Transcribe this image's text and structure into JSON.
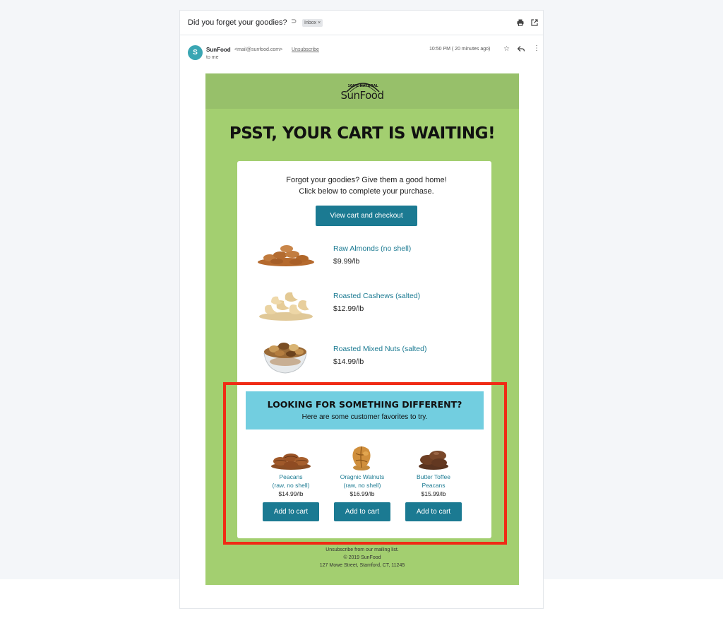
{
  "email": {
    "subject": "Did you forget your goodies?",
    "label": "Inbox",
    "label_close": "×",
    "sender_initial": "S",
    "sender_name": "SunFood",
    "sender_email": "<mail@sunfood.com>",
    "unsubscribe_link": "Unsubscribe",
    "recipient": "to me",
    "timestamp": "10:50 PM ( 20 minutes ago)"
  },
  "brand": {
    "logo_top": "100% NATURAL",
    "logo_name": "SunFood",
    "header_color": "#97c06a",
    "background_color": "#a3cf70",
    "accent_color": "#1b7a92",
    "promo_color": "#72cee0"
  },
  "headline": "PSST, YOUR CART IS WAITING!",
  "intro": {
    "line1": "Forgot your goodies? Give them a good home!",
    "line2": "Click below to complete your purchase."
  },
  "checkout_button": "View cart and checkout",
  "cart_items": [
    {
      "name": "Raw Almonds (no shell)",
      "price": "$9.99/lb",
      "icon": "almonds-image"
    },
    {
      "name": "Roasted Cashews (salted)",
      "price": "$12.99/lb",
      "icon": "cashews-image"
    },
    {
      "name": "Roasted Mixed Nuts (salted)",
      "price": "$14.99/lb",
      "icon": "mixed-nuts-image"
    }
  ],
  "promo": {
    "title": "LOOKING FOR SOMETHING DIFFERENT?",
    "subtitle": "Here are some customer favorites to try."
  },
  "favorites": [
    {
      "name_line1": "Peacans",
      "name_line2": "(raw, no shell)",
      "price": "$14.99/lb",
      "button": "Add to cart"
    },
    {
      "name_line1": "Oragnic Walnuts",
      "name_line2": "(raw, no shell)",
      "price": "$16.99/lb",
      "button": "Add to cart"
    },
    {
      "name_line1": "Butter Toffee",
      "name_line2": "Peacans",
      "price": "$15.99/lb",
      "button": "Add to cart"
    }
  ],
  "footer": {
    "line1": "Unsubscribe from our mailing list.",
    "line2": "© 2019 SunFood",
    "line3": "127 Mowe Street, Stamford, CT, 11245"
  },
  "highlight_color": "#f02b15"
}
